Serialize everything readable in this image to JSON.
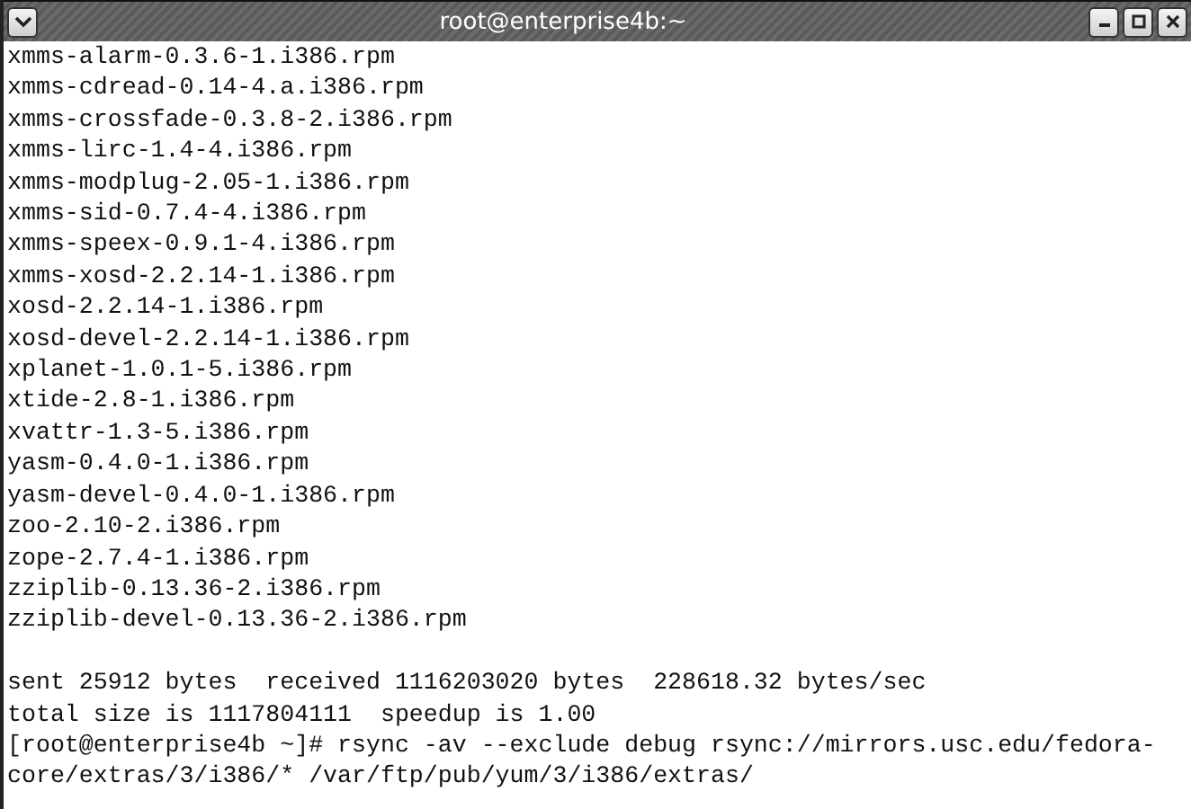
{
  "window": {
    "title": "root@enterprise4b:~"
  },
  "terminal": {
    "file_lines": [
      "xmms-alarm-0.3.6-1.i386.rpm",
      "xmms-cdread-0.14-4.a.i386.rpm",
      "xmms-crossfade-0.3.8-2.i386.rpm",
      "xmms-lirc-1.4-4.i386.rpm",
      "xmms-modplug-2.05-1.i386.rpm",
      "xmms-sid-0.7.4-4.i386.rpm",
      "xmms-speex-0.9.1-4.i386.rpm",
      "xmms-xosd-2.2.14-1.i386.rpm",
      "xosd-2.2.14-1.i386.rpm",
      "xosd-devel-2.2.14-1.i386.rpm",
      "xplanet-1.0.1-5.i386.rpm",
      "xtide-2.8-1.i386.rpm",
      "xvattr-1.3-5.i386.rpm",
      "yasm-0.4.0-1.i386.rpm",
      "yasm-devel-0.4.0-1.i386.rpm",
      "zoo-2.10-2.i386.rpm",
      "zope-2.7.4-1.i386.rpm",
      "zziplib-0.13.36-2.i386.rpm",
      "zziplib-devel-0.13.36-2.i386.rpm"
    ],
    "summary_lines": [
      "sent 25912 bytes  received 1116203020 bytes  228618.32 bytes/sec",
      "total size is 1117804111  speedup is 1.00",
      "[root@enterprise4b ~]# rsync -av --exclude debug rsync://mirrors.usc.edu/fedora-",
      "core/extras/3/i386/* /var/ftp/pub/yum/3/i386/extras/"
    ]
  }
}
